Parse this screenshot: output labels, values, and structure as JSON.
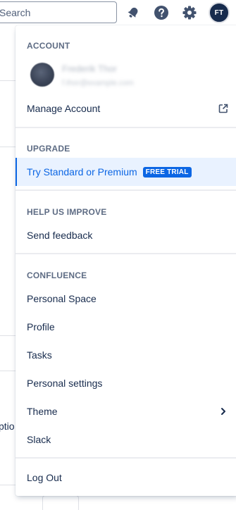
{
  "topbar": {
    "search_placeholder": "Search",
    "notifications_icon": "bell-icon",
    "help_icon": "help-icon",
    "settings_icon": "gear-icon",
    "avatar_initials": "FT"
  },
  "background": {
    "partial_text": "ptio"
  },
  "menu": {
    "account": {
      "header": "ACCOUNT",
      "user_name": "Frederik Thor",
      "user_email": "f.thor@example.com",
      "manage_label": "Manage Account"
    },
    "upgrade": {
      "header": "UPGRADE",
      "item_label": "Try Standard or Premium",
      "badge": "FREE TRIAL"
    },
    "help": {
      "header": "HELP US IMPROVE",
      "feedback_label": "Send feedback"
    },
    "confluence": {
      "header": "CONFLUENCE",
      "items": [
        "Personal Space",
        "Profile",
        "Tasks",
        "Personal settings",
        "Theme",
        "Slack"
      ]
    },
    "logout_label": "Log Out"
  },
  "colors": {
    "accent": "#0c66e4",
    "highlight_bg": "#e9f2ff",
    "text": "#172b4d",
    "subtle": "#5e6c84"
  }
}
